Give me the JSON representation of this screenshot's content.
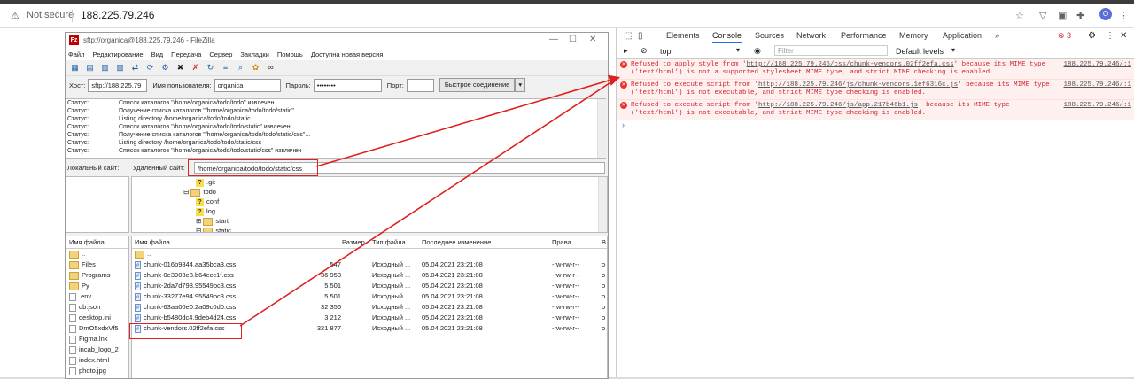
{
  "browser": {
    "security_label": "Not secure",
    "url": "188.225.79.246",
    "avatar_letter": "O"
  },
  "filezilla": {
    "window_title": "sftp://organica@188.225.79.246 - FileZilla",
    "menu": [
      "Файл",
      "Редактирование",
      "Вид",
      "Передача",
      "Сервер",
      "Закладки",
      "Помощь",
      "Доступна новая версия!"
    ],
    "quickconnect": {
      "host_label": "Хост:",
      "host_value": "sftp://188.225.79",
      "user_label": "Имя пользователя:",
      "user_value": "organica",
      "pass_label": "Пароль:",
      "pass_value": "••••••••",
      "port_label": "Порт:",
      "port_value": "",
      "connect_button": "Быстрое соединение"
    },
    "log": [
      {
        "status": "Статус:",
        "msg": "Список каталогов \"/home/organica/todo/todo\" извлечен"
      },
      {
        "status": "Статус:",
        "msg": "Получение списка каталогов \"/home/organica/todo/todo/static\"..."
      },
      {
        "status": "Статус:",
        "msg": "Listing directory /home/organica/todo/todo/static"
      },
      {
        "status": "Статус:",
        "msg": "Список каталогов \"/home/organica/todo/todo/static\" извлечен"
      },
      {
        "status": "Статус:",
        "msg": "Получение списка каталогов \"/home/organica/todo/todo/static/css\"..."
      },
      {
        "status": "Статус:",
        "msg": "Listing directory /home/organica/todo/todo/static/css"
      },
      {
        "status": "Статус:",
        "msg": "Список каталогов \"/home/organica/todo/todo/static/css\" извлечен"
      }
    ],
    "local_site_label": "Локальный сайт:",
    "remote_site_label": "Удаленный сайт:",
    "remote_path": "/home/organica/todo/todo/static/css",
    "remote_tree": [
      ".git",
      "todo",
      "conf",
      "log",
      "start",
      "static"
    ],
    "local_files_header": "Имя файла",
    "local_files": [
      "..",
      "Files",
      "Programs",
      "Py",
      ".env",
      "db.json",
      "desktop.ini",
      "DmO5xdxVf5",
      "Figma.lnk",
      "incab_logo_2",
      "index.html",
      "photo.jpg"
    ],
    "remote_columns": {
      "name": "Имя файла",
      "size": "Размер",
      "type": "Тип файла",
      "modified": "Последнее изменение",
      "perms": "Права",
      "owner": "В"
    },
    "remote_files": [
      {
        "name": "..",
        "size": "",
        "type": "",
        "modified": "",
        "perms": "",
        "owner": ""
      },
      {
        "name": "chunk-016b9844.aa35bca3.css",
        "size": "547",
        "type": "Исходный ...",
        "modified": "05.04.2021 23:21:08",
        "perms": "-rw-rw-r--",
        "owner": "o"
      },
      {
        "name": "chunk-0e3903e8.b64ecc1f.css",
        "size": "36 953",
        "type": "Исходный ...",
        "modified": "05.04.2021 23:21:08",
        "perms": "-rw-rw-r--",
        "owner": "o"
      },
      {
        "name": "chunk-2da7d798.95549bc3.css",
        "size": "5 501",
        "type": "Исходный ...",
        "modified": "05.04.2021 23:21:08",
        "perms": "-rw-rw-r--",
        "owner": "o"
      },
      {
        "name": "chunk-33277e94.95549bc3.css",
        "size": "5 501",
        "type": "Исходный ...",
        "modified": "05.04.2021 23:21:08",
        "perms": "-rw-rw-r--",
        "owner": "o"
      },
      {
        "name": "chunk-63aa00e0.2a09c0d0.css",
        "size": "32 356",
        "type": "Исходный ...",
        "modified": "05.04.2021 23:21:08",
        "perms": "-rw-rw-r--",
        "owner": "o"
      },
      {
        "name": "chunk-b5480dc4.9deb4d24.css",
        "size": "3 212",
        "type": "Исходный ...",
        "modified": "05.04.2021 23:21:08",
        "perms": "-rw-rw-r--",
        "owner": "o"
      },
      {
        "name": "chunk-vendors.02ff2efa.css",
        "size": "321 877",
        "type": "Исходный ...",
        "modified": "05.04.2021 23:21:08",
        "perms": "-rw-rw-r--",
        "owner": "o"
      }
    ]
  },
  "devtools": {
    "tabs": [
      "Elements",
      "Console",
      "Sources",
      "Network",
      "Performance",
      "Memory",
      "Application"
    ],
    "more": "»",
    "error_count": "3",
    "context": "top",
    "filter_placeholder": "Filter",
    "levels": "Default levels",
    "errors": [
      {
        "pre": "Refused to apply style from '",
        "link": "http://188.225.79.246/css/chunk-vendors.02ff2efa.css",
        "post": "' because its MIME type ('text/html') is not a supported stylesheet MIME type, and strict MIME checking is enabled.",
        "source": "188.225.79.246/:1"
      },
      {
        "pre": "Refused to execute script from '",
        "link": "http://188.225.79.246/js/chunk-vendors.1ef6316c.js",
        "post": "' because its MIME type ('text/html') is not executable, and strict MIME type checking is enabled.",
        "source": "188.225.79.246/:1"
      },
      {
        "pre": "Refused to execute script from '",
        "link": "http://188.225.79.246/js/app.217b46b1.js",
        "post": "' because its MIME type ('text/html') is not executable, and strict MIME type checking is enabled.",
        "source": "188.225.79.246/:1"
      }
    ],
    "prompt": "›"
  },
  "colors": {
    "annotation": "#e02020",
    "error_text": "#d1242f",
    "error_bg": "#fff0f0",
    "accent": "#1a73e8"
  }
}
